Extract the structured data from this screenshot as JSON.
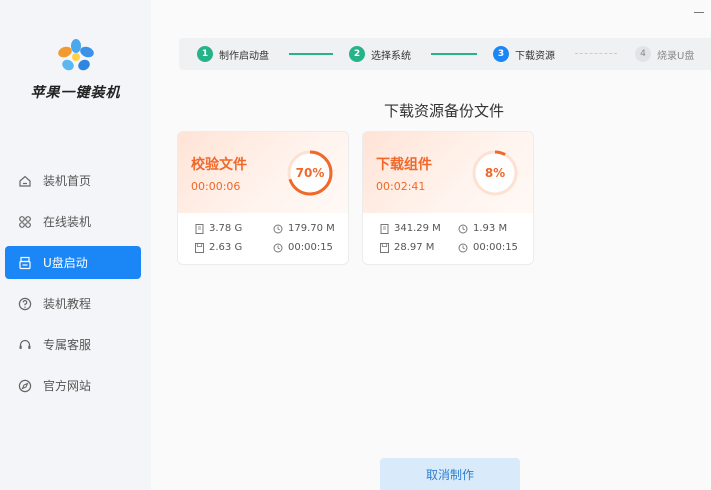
{
  "app": {
    "name": "苹果一键装机"
  },
  "sidebar": {
    "items": [
      {
        "label": "装机首页",
        "icon": "home-icon",
        "active": false
      },
      {
        "label": "在线装机",
        "icon": "online-install-icon",
        "active": false
      },
      {
        "label": "U盘启动",
        "icon": "usb-icon",
        "active": true
      },
      {
        "label": "装机教程",
        "icon": "help-icon",
        "active": false
      },
      {
        "label": "专属客服",
        "icon": "headset-icon",
        "active": false
      },
      {
        "label": "官方网站",
        "icon": "compass-icon",
        "active": false
      }
    ]
  },
  "steps": [
    {
      "num": "1",
      "label": "制作启动盘",
      "state": "done"
    },
    {
      "num": "2",
      "label": "选择系统",
      "state": "done"
    },
    {
      "num": "3",
      "label": "下载资源",
      "state": "active"
    },
    {
      "num": "4",
      "label": "烧录U盘",
      "state": "pending"
    }
  ],
  "main": {
    "title": "下载资源备份文件",
    "cancel_label": "取消制作"
  },
  "cards": [
    {
      "title": "校验文件",
      "time": "00:00:06",
      "percent_label": "70%",
      "progress": 0.7,
      "stats": {
        "total_size": "3.78 G",
        "speed": "179.70 M",
        "done_size": "2.63 G",
        "remaining": "00:00:15"
      }
    },
    {
      "title": "下载组件",
      "time": "00:02:41",
      "percent_label": "8%",
      "progress": 0.08,
      "stats": {
        "total_size": "341.29 M",
        "speed": "1.93 M",
        "done_size": "28.97 M",
        "remaining": "00:00:15"
      }
    }
  ],
  "colors": {
    "accent": "#1b86f5",
    "done": "#27b38a",
    "progress": "#f0682a"
  }
}
